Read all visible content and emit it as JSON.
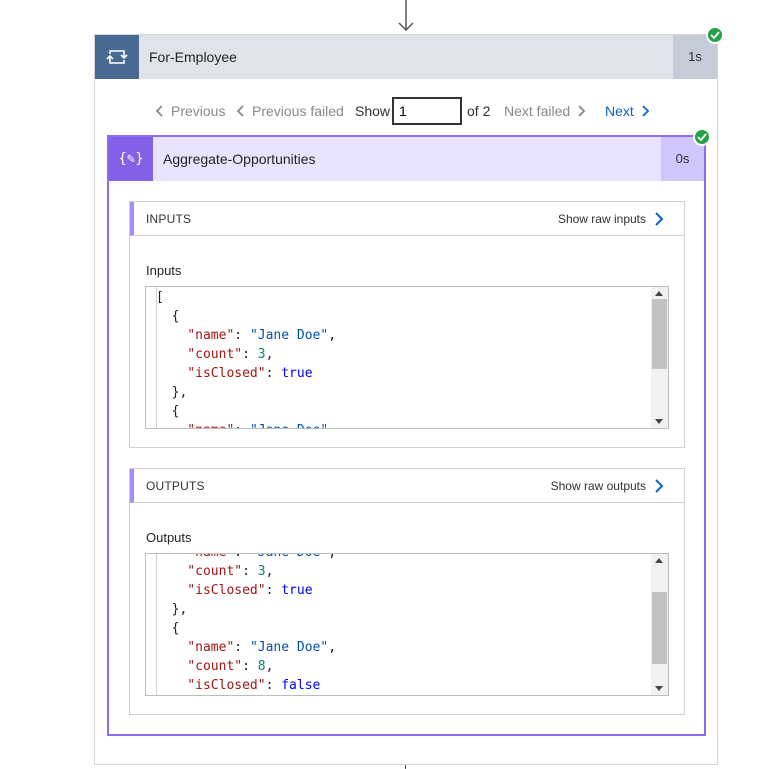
{
  "loop": {
    "title": "For-Employee",
    "duration": "1s",
    "status_color": "#24a148"
  },
  "pager": {
    "previous": "Previous",
    "previous_failed": "Previous failed",
    "show": "Show",
    "current_page": "1",
    "of_total": "of 2",
    "next_failed": "Next failed",
    "next": "Next"
  },
  "action": {
    "title": "Aggregate-Opportunities",
    "duration": "0s",
    "icon_glyph": "{✎}",
    "accent_color": "#8360e6"
  },
  "inputs": {
    "section_label": "INPUTS",
    "raw_link": "Show raw inputs",
    "field_label": "Inputs"
  },
  "outputs": {
    "section_label": "OUTPUTS",
    "raw_link": "Show raw outputs",
    "field_label": "Outputs"
  },
  "icons": {
    "loop": "loop-icon",
    "compose": "compose-icon",
    "check": "check-icon",
    "chevron_left": "chevron-left-icon",
    "chevron_right": "chevron-right-icon",
    "arrow_down": "arrow-down-icon"
  }
}
